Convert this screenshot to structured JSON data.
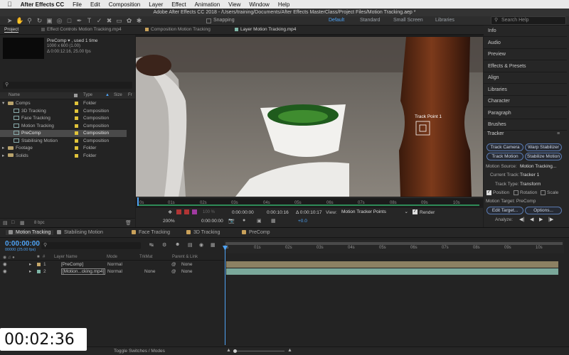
{
  "menubar": {
    "apple": "",
    "items": [
      "After Effects CC",
      "File",
      "Edit",
      "Composition",
      "Layer",
      "Effect",
      "Animation",
      "View",
      "Window",
      "Help"
    ]
  },
  "window_title": "Adobe After Effects CC 2018 - /Users/training/Documents/After Effects MasterClass/Project Files/Motion Tracking.aep *",
  "toolbar": {
    "snapping_label": "Snapping",
    "workspaces": [
      "Default",
      "Standard",
      "Small Screen",
      "Libraries"
    ],
    "search_placeholder": "Search Help"
  },
  "project_panel": {
    "tab_project": "Project",
    "tab_effect_controls": "Effect Controls Motion Tracking.mp4",
    "preview_name": "PreComp ▾ , used 1 time",
    "preview_info1": "1000 x 600 (1.00)",
    "preview_info2": "Δ 0:00:12:16, 25.00 fps",
    "col_name": "Name",
    "col_type": "Type",
    "col_size": "Size",
    "col_fr": "Fr",
    "items": [
      {
        "name": "Comps",
        "type": "Folder",
        "kind": "folder",
        "indent": 0,
        "color": "#e0c33a",
        "selected": false
      },
      {
        "name": "3D Tracking",
        "type": "Composition",
        "kind": "comp",
        "indent": 1,
        "color": "#e0c33a",
        "selected": false
      },
      {
        "name": "Face Tracking",
        "type": "Composition",
        "kind": "comp",
        "indent": 1,
        "color": "#e0c33a",
        "selected": false
      },
      {
        "name": "Motion Tracking",
        "type": "Composition",
        "kind": "comp",
        "indent": 1,
        "color": "#e0c33a",
        "selected": false
      },
      {
        "name": "PreComp",
        "type": "Composition",
        "kind": "comp",
        "indent": 1,
        "color": "#e0c33a",
        "selected": true
      },
      {
        "name": "Stabilising Motion",
        "type": "Composition",
        "kind": "comp",
        "indent": 1,
        "color": "#e0c33a",
        "selected": false
      },
      {
        "name": "Footage",
        "type": "Folder",
        "kind": "folder",
        "indent": 0,
        "color": "#e0c33a",
        "selected": false
      },
      {
        "name": "Solids",
        "type": "Folder",
        "kind": "folder",
        "indent": 0,
        "color": "#e0c33a",
        "selected": false
      }
    ],
    "bpc": "8 bpc"
  },
  "viewer": {
    "tab_composition": "Composition Motion Tracking",
    "tab_layer": "Layer Motion Tracking.mp4",
    "track_point_label": "Track Point 1",
    "ruler": [
      "0s",
      "01s",
      "02s",
      "03s",
      "04s",
      "05s",
      "06s",
      "07s",
      "08s",
      "09s",
      "10s"
    ],
    "zoom": "200%",
    "time_current": "0:00:00:00",
    "time_in": "0:00:00:00",
    "time_out": "0:00:10:16",
    "time_dur": "Δ 0:00:10:17",
    "view_label": "View:",
    "view_value": "Motion Tracker Points",
    "render_label": "Render",
    "offset": "+0.0",
    "res": "100 %"
  },
  "right_panel": {
    "items": [
      "Info",
      "Audio",
      "Preview",
      "Effects & Presets",
      "Align",
      "Libraries",
      "Character",
      "Paragraph",
      "Brushes"
    ],
    "tracker_title": "Tracker",
    "buttons": [
      "Track Camera",
      "Warp Stabilizer",
      "Track Motion",
      "Stabilize Motion"
    ],
    "motion_source_label": "Motion Source:",
    "motion_source_value": "Motion Tracking...",
    "current_track_label": "Current Track:",
    "current_track_value": "Tracker 1",
    "track_type_label": "Track Type:",
    "track_type_value": "Transform",
    "chk_position": "Position",
    "chk_rotation": "Rotation",
    "chk_scale": "Scale",
    "motion_target": "Motion Target: PreComp",
    "edit_target": "Edit Target...",
    "options": "Options...",
    "analyze_label": "Analyze:"
  },
  "timeline": {
    "tabs": [
      {
        "label": "Motion Tracking",
        "color": "#8e8e8e",
        "active": true
      },
      {
        "label": "Stabilising Motion",
        "color": "#8e8e8e",
        "active": false
      },
      {
        "label": "Face Tracking",
        "color": "#c9a15a",
        "active": false
      },
      {
        "label": "3D Tracking",
        "color": "#c9a15a",
        "active": false
      },
      {
        "label": "PreComp",
        "color": "#c9a15a",
        "active": false
      }
    ],
    "timecode": "0:00:00:00",
    "fps": "00000 (25.00 fps)",
    "col_layer_name": "Layer Name",
    "col_mode": "Mode",
    "col_trkmat": "TrkMat",
    "col_parent": "Parent & Link",
    "ruler": [
      "0s",
      "01s",
      "02s",
      "03s",
      "04s",
      "05s",
      "06s",
      "07s",
      "08s",
      "09s",
      "10s"
    ],
    "layers": [
      {
        "num": "1",
        "name": "[PreComp]",
        "mode": "Normal",
        "trkmat": "",
        "parent": "None",
        "color": "#c7a86a",
        "bar": "#8c8163"
      },
      {
        "num": "2",
        "name": "[Motion...cking.mp4]",
        "mode": "Normal",
        "trkmat": "None",
        "parent": "None",
        "color": "#7fb7a8",
        "bar": "#7aa89a"
      }
    ],
    "toggle": "Toggle Switches / Modes",
    "overlay_time": "00:02:36"
  }
}
